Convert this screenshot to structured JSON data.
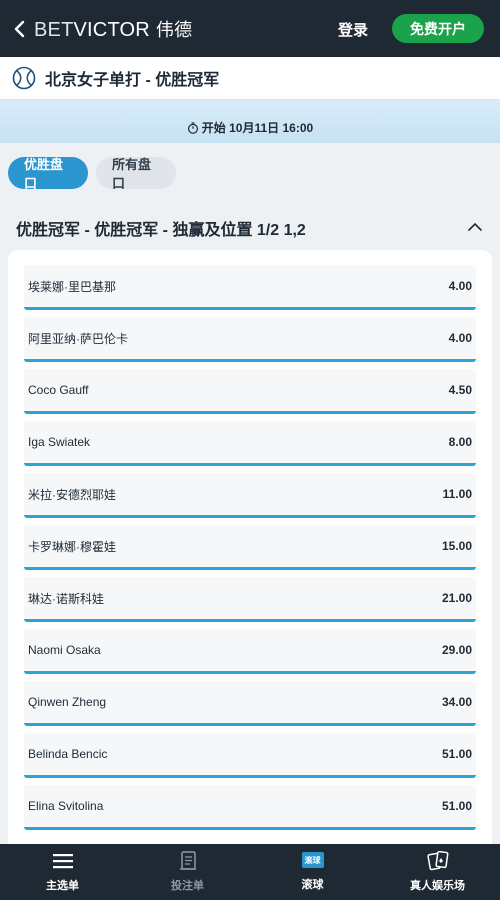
{
  "header": {
    "logo_bet": "BET",
    "logo_victor": "VICTOR",
    "logo_cn": "伟德",
    "login_label": "登录",
    "register_label": "免费开户"
  },
  "event": {
    "title": "北京女子单打 - 优胜冠军",
    "start_text": "开始 10月11日 16:00"
  },
  "tabs": [
    {
      "label": "优胜盘口",
      "active": true
    },
    {
      "label": "所有盘口",
      "active": false
    }
  ],
  "market": {
    "title": "优胜冠军 - 优胜冠军 - 独赢及位置 1/2 1,2",
    "expanded": true
  },
  "selections": [
    {
      "name": "埃莱娜·里巴基那",
      "odds": "4.00"
    },
    {
      "name": "阿里亚纳·萨巴伦卡",
      "odds": "4.00"
    },
    {
      "name": "Coco Gauff",
      "odds": "4.50"
    },
    {
      "name": "Iga Swiatek",
      "odds": "8.00"
    },
    {
      "name": "米拉·安德烈耶娃",
      "odds": "11.00"
    },
    {
      "name": "卡罗琳娜·穆霍娃",
      "odds": "15.00"
    },
    {
      "name": "琳达·诺斯科娃",
      "odds": "21.00"
    },
    {
      "name": "Naomi Osaka",
      "odds": "29.00"
    },
    {
      "name": "Qinwen Zheng",
      "odds": "34.00"
    },
    {
      "name": "Belinda Bencic",
      "odds": "51.00"
    },
    {
      "name": "Elina Svitolina",
      "odds": "51.00"
    }
  ],
  "bottom_nav": [
    {
      "label": "主选单",
      "icon": "menu-icon"
    },
    {
      "label": "投注单",
      "icon": "betslip-icon"
    },
    {
      "label": "滚球",
      "icon": "live-icon",
      "icon_text": "滚球"
    },
    {
      "label": "真人娱乐场",
      "icon": "cards-icon"
    }
  ],
  "colors": {
    "header_bg": "#1f2933",
    "accent_blue": "#2b95cf",
    "register_green": "#1aa34a"
  }
}
